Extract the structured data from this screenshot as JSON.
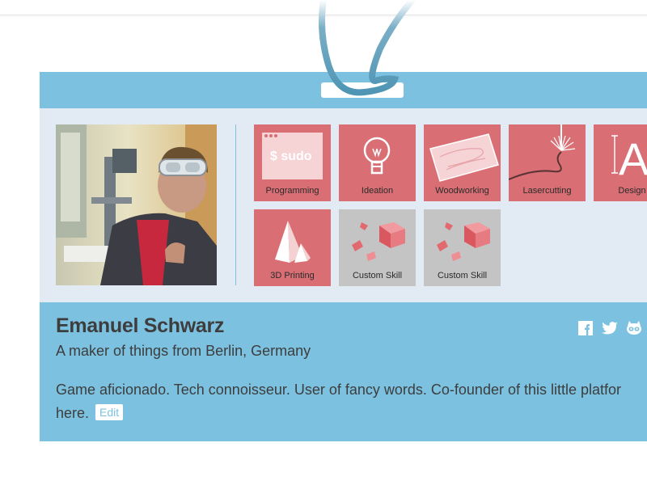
{
  "profile": {
    "name": "Emanuel Schwarz",
    "location": "A maker of things from Berlin, Germany",
    "bio_line1": "Game aficionado. Tech connoisseur. User of fancy words. Co-founder of this little platfor",
    "bio_line2": "here.",
    "edit_label": "Edit"
  },
  "skills": [
    {
      "label": "Programming",
      "icon": "terminal-icon",
      "tile_text": "$ sudo"
    },
    {
      "label": "Ideation",
      "icon": "lightbulb-icon"
    },
    {
      "label": "Woodworking",
      "icon": "wood-plank-icon"
    },
    {
      "label": "Lasercutting",
      "icon": "laser-icon"
    },
    {
      "label": "Design",
      "icon": "type-a-icon",
      "tile_text": "A"
    },
    {
      "label": "3D Printing",
      "icon": "pyramid-icon"
    },
    {
      "label": "Custom Skill",
      "icon": "cubes-icon"
    },
    {
      "label": "Custom Skill",
      "icon": "cubes-icon"
    }
  ],
  "social": [
    "facebook-icon",
    "twitter-icon",
    "instructables-icon"
  ],
  "colors": {
    "accent": "#7cc2e0",
    "card_bg": "#e2ebf3",
    "skill_tile": "#d96f75",
    "custom_tile": "#c4c4c4",
    "text": "#3d3d3d"
  }
}
